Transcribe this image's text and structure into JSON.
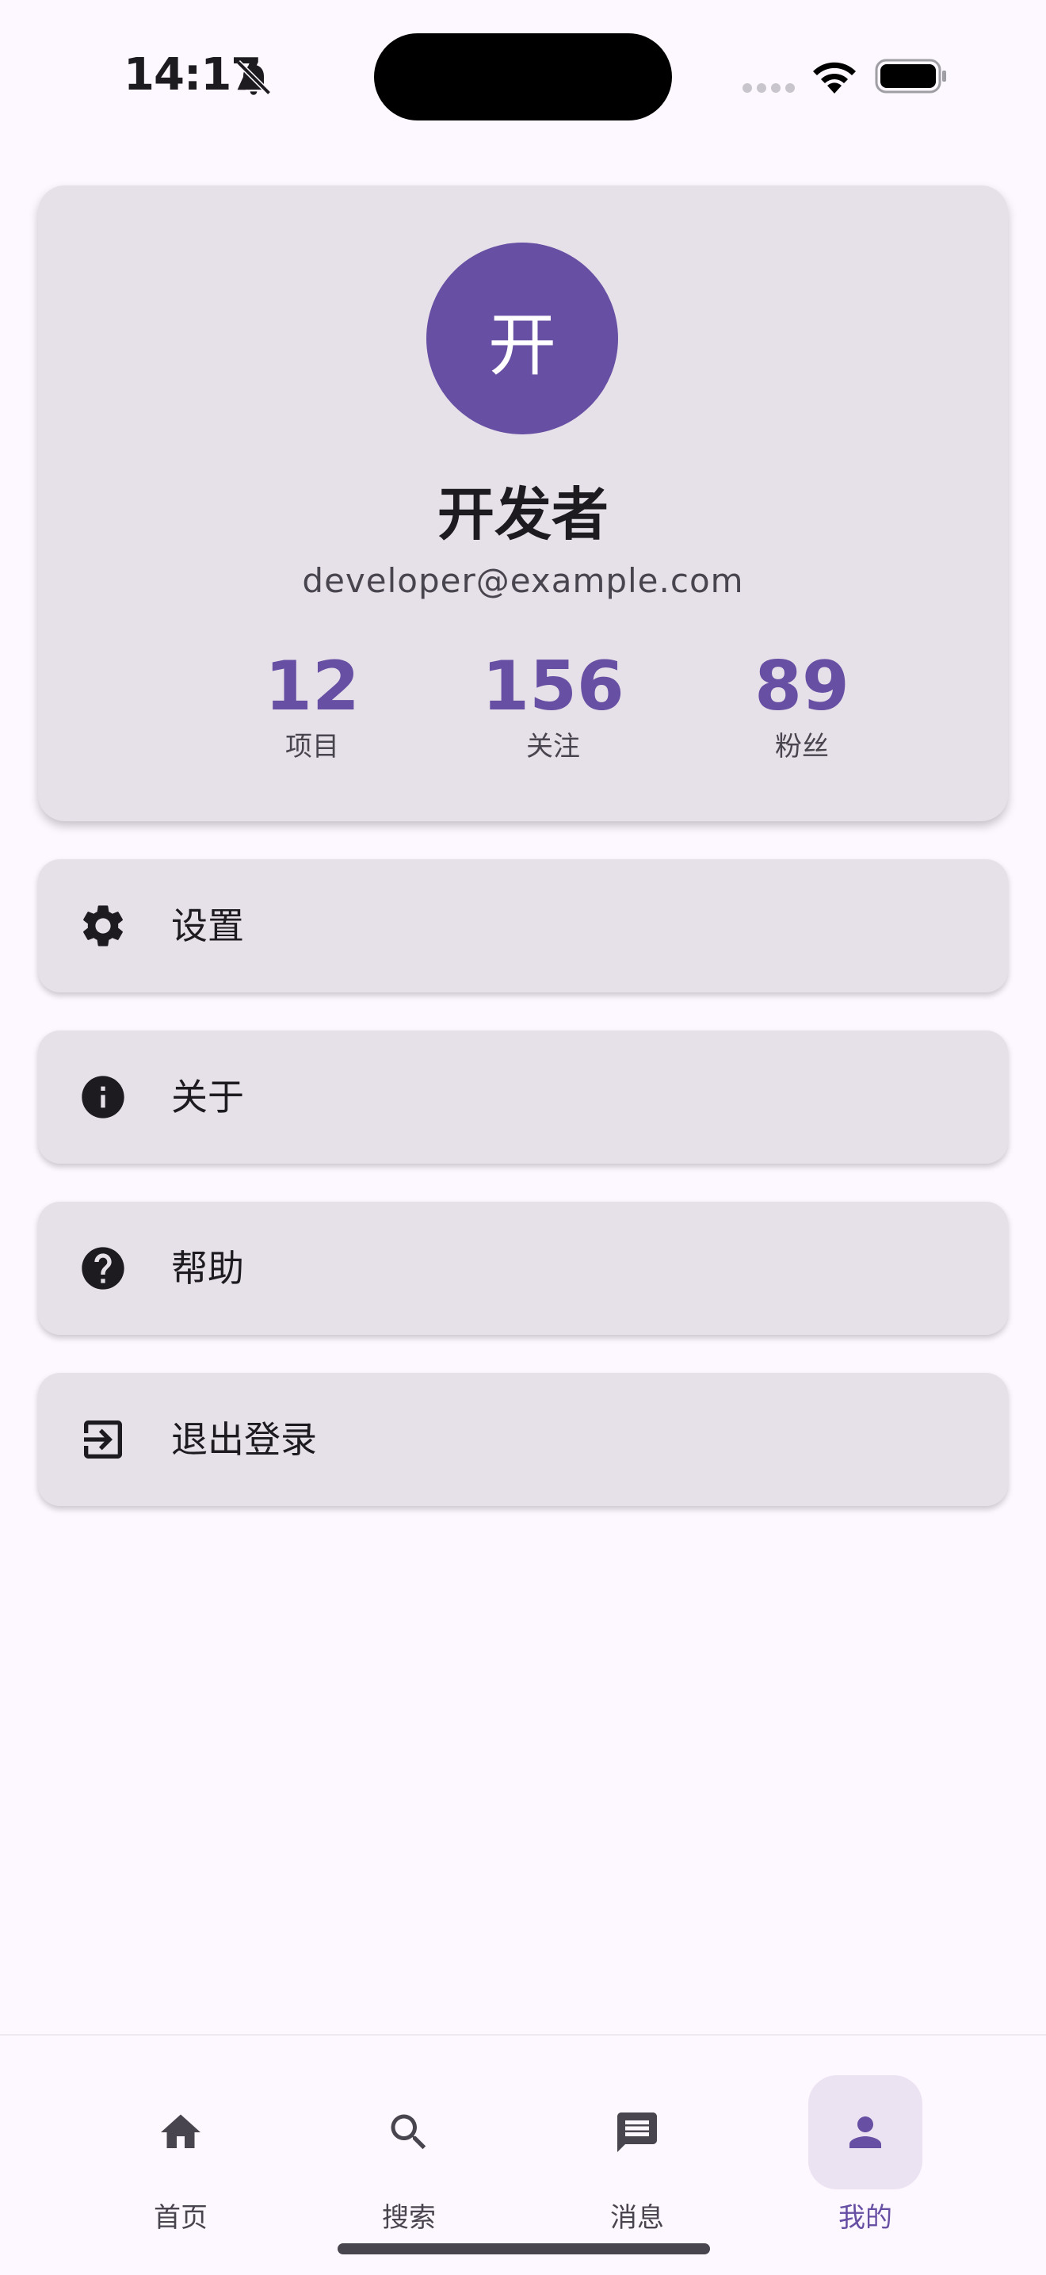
{
  "status_bar": {
    "time": "14:17",
    "icons": [
      "bell-off-icon",
      "signal-icon",
      "wifi-icon",
      "battery-icon"
    ]
  },
  "profile": {
    "avatar_initial": "开",
    "name": "开发者",
    "email": "developer@example.com",
    "stats": [
      {
        "value": "12",
        "label": "项目"
      },
      {
        "value": "156",
        "label": "关注"
      },
      {
        "value": "89",
        "label": "粉丝"
      }
    ]
  },
  "menu": [
    {
      "label": "设置",
      "icon": "gear-icon"
    },
    {
      "label": "关于",
      "icon": "info-icon"
    },
    {
      "label": "帮助",
      "icon": "help-icon"
    },
    {
      "label": "退出登录",
      "icon": "logout-icon"
    }
  ],
  "bottom_nav": {
    "items": [
      {
        "label": "首页",
        "icon": "home-icon"
      },
      {
        "label": "搜索",
        "icon": "search-icon"
      },
      {
        "label": "消息",
        "icon": "message-icon"
      },
      {
        "label": "我的",
        "icon": "person-icon"
      }
    ],
    "active_index": 3
  },
  "colors": {
    "primary": "#674FA3",
    "surface": "#FDF7FF",
    "card": "#E6E0E9",
    "on_surface": "#1D1B20",
    "on_surface_variant": "#49454F",
    "active_indicator": "#EBE3F2"
  }
}
